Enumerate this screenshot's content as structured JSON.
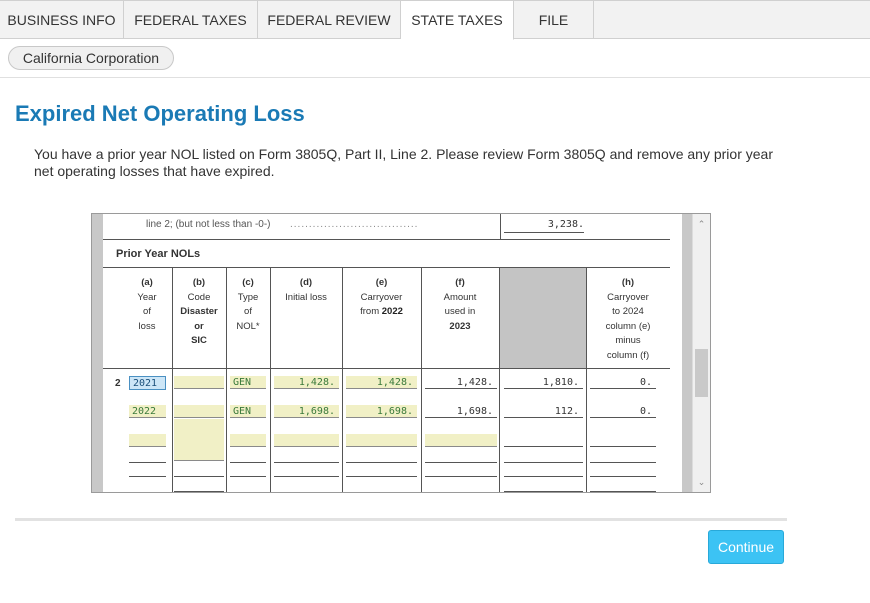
{
  "tabs": [
    {
      "label": "BUSINESS INFO",
      "active": false
    },
    {
      "label": "FEDERAL TAXES",
      "active": false
    },
    {
      "label": "FEDERAL REVIEW",
      "active": false
    },
    {
      "label": "STATE TAXES",
      "active": true
    },
    {
      "label": "FILE",
      "active": false
    }
  ],
  "entity": "California Corporation",
  "page_title": "Expired Net Operating Loss",
  "description": "You have a prior year NOL listed on Form 3805Q, Part II, Line 2. Please review Form 3805Q and remove any prior year net operating losses that have expired.",
  "form": {
    "top_line_label": "line 2; (but not less than -0-)",
    "top_line_value": "3,238.",
    "section_title": "Prior Year NOLs",
    "columns": {
      "a": {
        "letter": "(a)",
        "lines": [
          "Year",
          "of",
          "loss"
        ]
      },
      "b": {
        "letter": "(b)",
        "lines": [
          "Code",
          "Disaster",
          "or",
          "SIC"
        ]
      },
      "c": {
        "letter": "(c)",
        "lines": [
          "Type",
          "of",
          "NOL*"
        ]
      },
      "d": {
        "letter": "(d)",
        "lines": [
          "Initial loss"
        ]
      },
      "e": {
        "letter": "(e)",
        "lines": [
          "Carryover",
          "from 2022"
        ]
      },
      "f": {
        "letter": "(f)",
        "lines": [
          "Amount",
          "used in",
          "2023"
        ]
      },
      "h": {
        "letter": "(h)",
        "lines": [
          "Carryover",
          "to 2024",
          "column (e)",
          "minus",
          "column (f)"
        ]
      }
    },
    "row_line_number": "2",
    "rows": [
      {
        "year": "2021",
        "code": "",
        "type": "GEN",
        "initial_loss": "1,428.",
        "carryover_2022": "1,428.",
        "used_2023": "1,428.",
        "col_g": "1,810.",
        "carryover_2024": "0."
      },
      {
        "year": "2022",
        "code": "",
        "type": "GEN",
        "initial_loss": "1,698.",
        "carryover_2022": "1,698.",
        "used_2023": "1,698.",
        "col_g": "112.",
        "carryover_2024": "0."
      }
    ]
  },
  "continue_label": "Continue",
  "colors": {
    "title_blue": "#1a7ab5",
    "continue_button": "#3cc3f4",
    "input_yellow": "#f1f0c6",
    "selected_cell": "#cde6f7"
  }
}
